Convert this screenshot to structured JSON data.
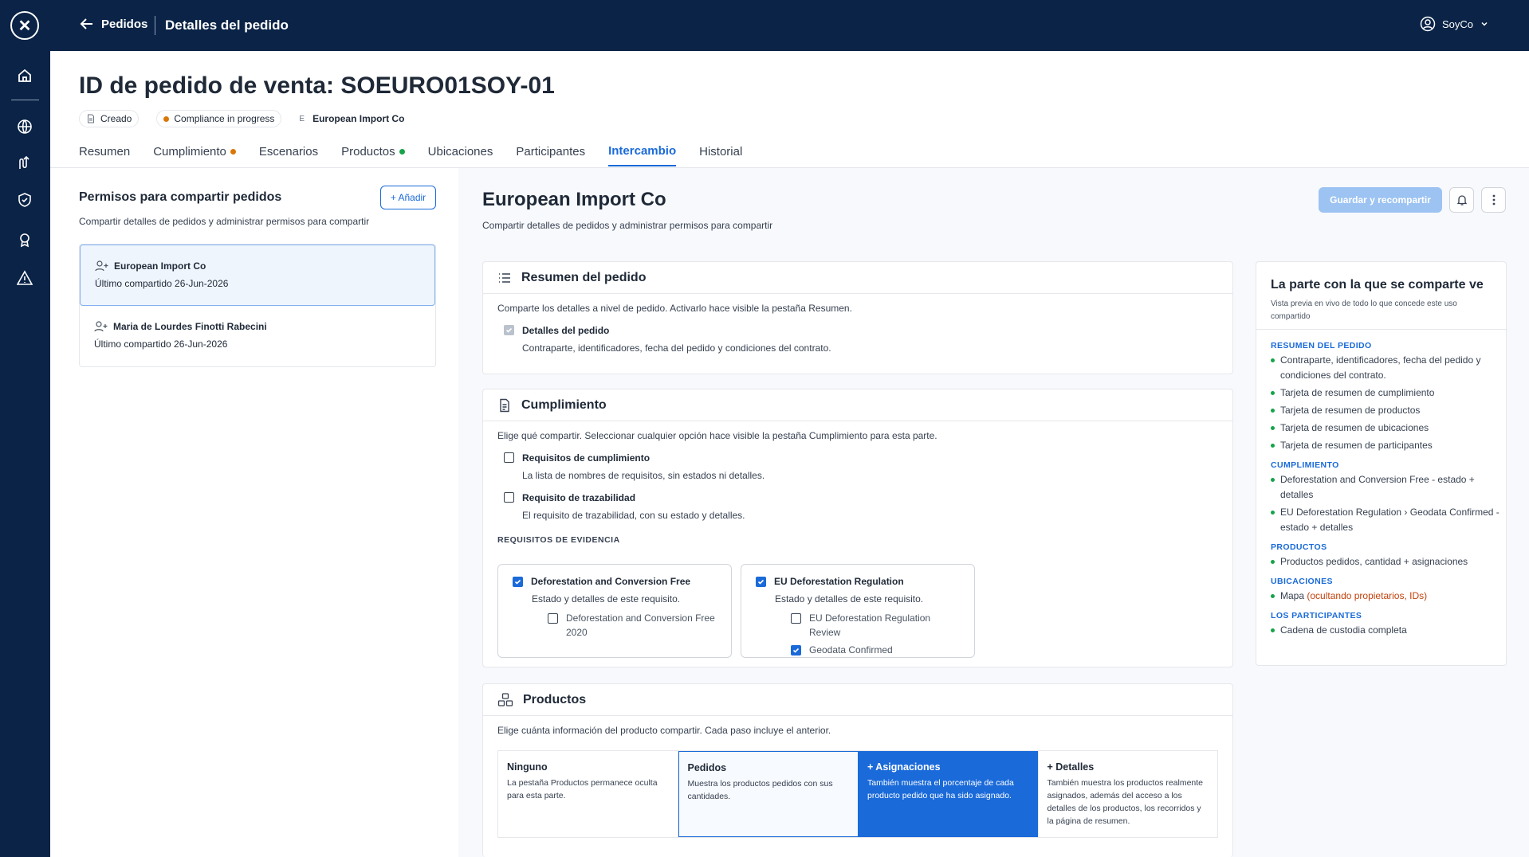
{
  "topbar": {
    "back_label": "Pedidos",
    "crumb": "Detalles del pedido",
    "user": "SoyCo"
  },
  "page": {
    "title": "ID de pedido de venta: SOEURO01SOY-01",
    "chips": [
      {
        "label": "Creado",
        "icon": "document-icon"
      },
      {
        "label": "Compliance in progress",
        "color": "#d97706"
      },
      {
        "label": "European Import Co",
        "prefix": "E"
      }
    ],
    "tabs": [
      {
        "label": "Resumen"
      },
      {
        "label": "Cumplimiento",
        "dot": "#d97706"
      },
      {
        "label": "Escenarios"
      },
      {
        "label": "Productos",
        "dot": "#16a34a"
      },
      {
        "label": "Ubicaciones"
      },
      {
        "label": "Participantes"
      },
      {
        "label": "Intercambio",
        "active": true
      },
      {
        "label": "Historial"
      }
    ]
  },
  "left": {
    "title": "Permisos para compartir pedidos",
    "add_label": "+ Añadir",
    "subtitle": "Compartir detalles de pedidos y administrar permisos para compartir",
    "parties": [
      {
        "name": "European Import Co",
        "last": "Último compartido 26-Jun-2026",
        "selected": true
      },
      {
        "name": "Maria de Lourdes Finotti Rabecini",
        "last": "Último compartido 26-Jun-2026"
      }
    ]
  },
  "main": {
    "title": "European Import Co",
    "subtitle": "Compartir detalles de pedidos y administrar permisos para compartir",
    "save_label": "Guardar y recompartir",
    "resumen": {
      "title": "Resumen del pedido",
      "desc": "Comparte los detalles a nivel de pedido. Activarlo hace visible la pestaña Resumen.",
      "opt_title": "Detalles del pedido",
      "opt_desc": "Contraparte, identificadores, fecha del pedido y condiciones del contrato."
    },
    "cumplimiento": {
      "title": "Cumplimiento",
      "desc": "Elige qué compartir. Seleccionar cualquier opción hace visible la pestaña Cumplimiento para esta parte.",
      "opt1_title": "Requisitos de cumplimiento",
      "opt1_desc": "La lista de nombres de requisitos, sin estados ni detalles.",
      "opt2_title": "Requisito de trazabilidad",
      "opt2_desc": "El requisito de trazabilidad, con su estado y detalles.",
      "evidence_label": "REQUISITOS DE EVIDENCIA",
      "ev1": {
        "title": "Deforestation and Conversion Free",
        "desc": "Estado y detalles de este requisito.",
        "sub1": "Deforestation and Conversion Free 2020"
      },
      "ev2": {
        "title": "EU Deforestation Regulation",
        "desc": "Estado y detalles de este requisito.",
        "sub1": "EU Deforestation Regulation Review",
        "sub2": "Geodata Confirmed"
      }
    },
    "productos": {
      "title": "Productos",
      "desc": "Elige cuánta información del producto compartir. Cada paso incluye el anterior.",
      "levels": [
        {
          "title": "Ninguno",
          "desc": "La pestaña Productos permanece oculta para esta parte."
        },
        {
          "title": "Pedidos",
          "desc": "Muestra los productos pedidos con sus cantidades."
        },
        {
          "title": "+ Asignaciones",
          "desc": "También muestra el porcentaje de cada producto pedido que ha sido asignado.",
          "selected": true
        },
        {
          "title": "+ Detalles",
          "desc": "También muestra los productos realmente asignados, además del acceso a los detalles de los productos, los recorridos y la página de resumen."
        }
      ]
    }
  },
  "preview": {
    "title": "La parte con la que se comparte ve",
    "subtitle": "Vista previa en vivo de todo lo que concede este uso compartido",
    "s1": "RESUMEN DEL PEDIDO",
    "s1_items": [
      "Contraparte, identificadores, fecha del pedido y condiciones del contrato.",
      "Tarjeta de resumen de cumplimiento",
      "Tarjeta de resumen de productos",
      "Tarjeta de resumen de ubicaciones",
      "Tarjeta de resumen de participantes"
    ],
    "s2": "CUMPLIMIENTO",
    "s2_items": [
      "Deforestation and Conversion Free - estado + detalles",
      "EU Deforestation Regulation › Geodata Confirmed - estado + detalles"
    ],
    "s3": "PRODUCTOS",
    "s3_items": [
      "Productos pedidos, cantidad + asignaciones"
    ],
    "s4": "UBICACIONES",
    "s4_item": "Mapa",
    "s4_note": "(ocultando propietarios, IDs)",
    "s5": "LOS PARTICIPANTES",
    "s5_items": [
      "Cadena de custodia completa"
    ]
  }
}
